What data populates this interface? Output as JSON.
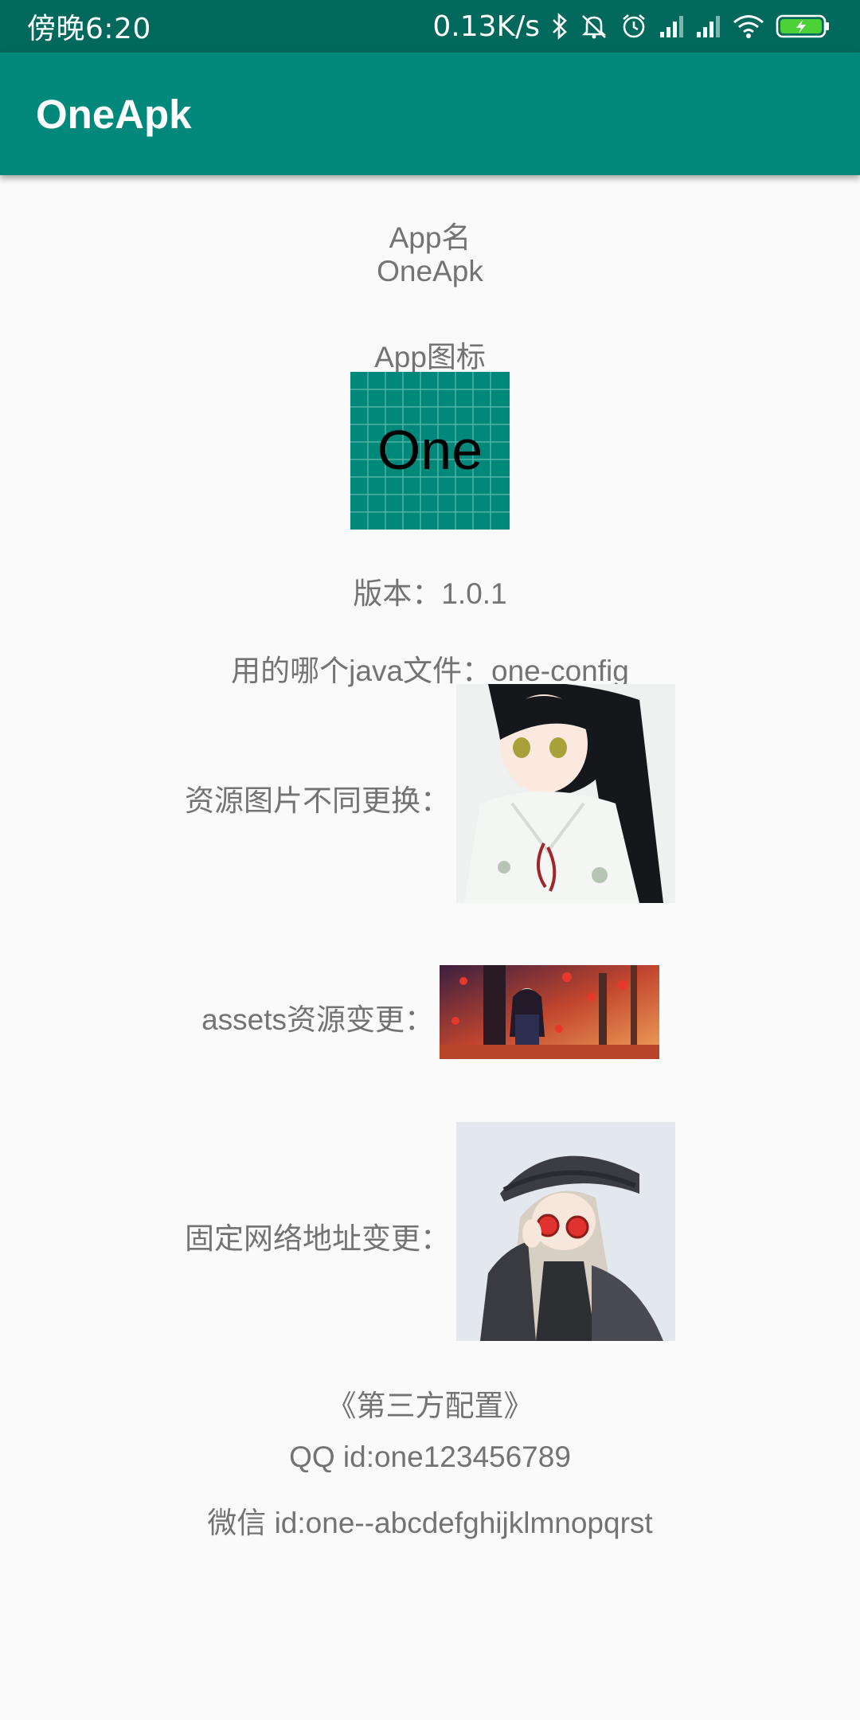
{
  "status_bar": {
    "time": "傍晚6:20",
    "net_speed": "0.13K/s",
    "icons": [
      "bluetooth-icon",
      "mute-icon",
      "alarm-icon",
      "signal-icon",
      "signal-icon",
      "wifi-icon",
      "battery-charging-icon"
    ]
  },
  "toolbar": {
    "title": "OneApk"
  },
  "content": {
    "app_name_label": "App名",
    "app_name_value": "OneApk",
    "app_icon_label": "App图标",
    "app_icon_text": "One",
    "version_line": "版本：1.0.1",
    "java_file_line": "用的哪个java文件：one-config",
    "res_image_label": "资源图片不同更换：",
    "assets_label": "assets资源变更：",
    "network_label": "固定网络地址变更：",
    "third_party_title": "《第三方配置》",
    "qq_line": "QQ id:one123456789",
    "wechat_line": "微信 id:one--abcdefghijklmnopqrst"
  },
  "colors": {
    "status_bar": "#00695c",
    "toolbar": "#00897b",
    "icon_bg": "#00897b",
    "text": "#737373",
    "background": "#fafafa"
  }
}
